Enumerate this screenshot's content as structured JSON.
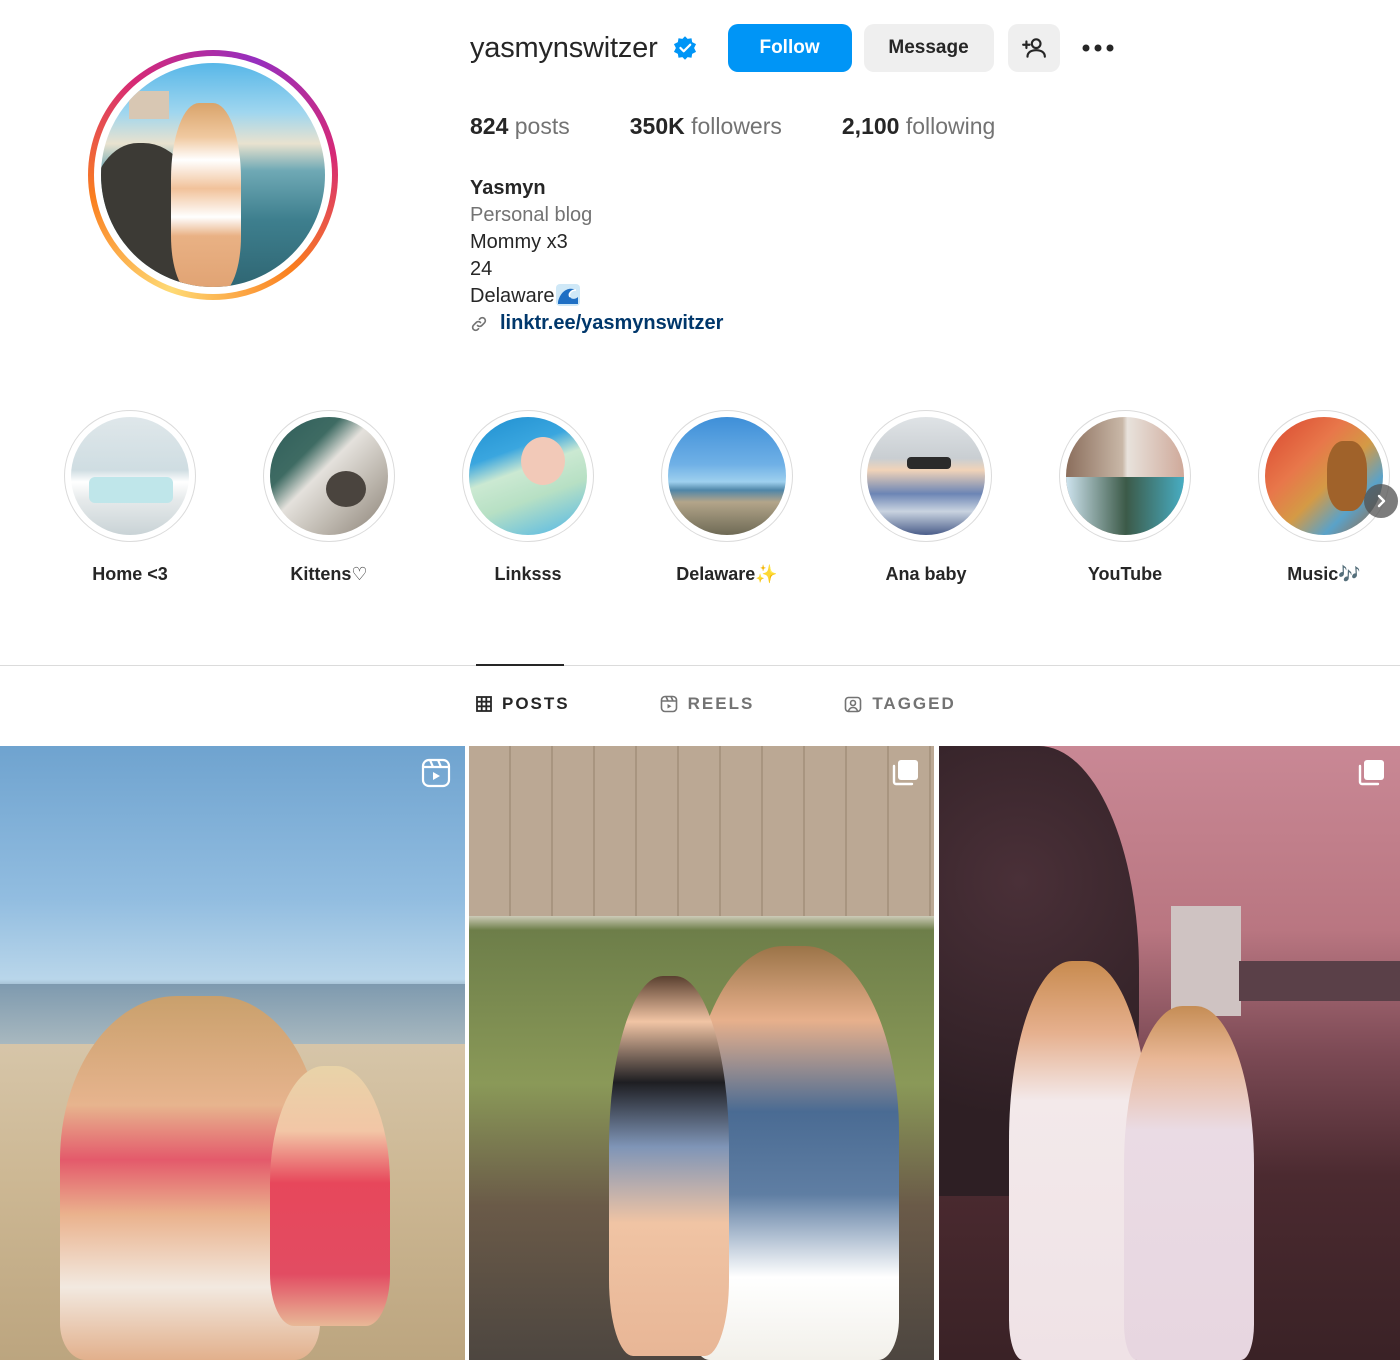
{
  "profile": {
    "username": "yasmynswitzer",
    "verified": true,
    "actions": {
      "follow_label": "Follow",
      "message_label": "Message",
      "add_user_icon": "person-add-icon",
      "more_icon": "more-options-icon"
    },
    "stats": {
      "posts_count": "824",
      "posts_label": "posts",
      "followers_count": "350K",
      "followers_label": "followers",
      "following_count": "2,100",
      "following_label": "following"
    },
    "bio": {
      "name": "Yasmyn",
      "category": "Personal blog",
      "line1": "Mommy x3",
      "line2": "24",
      "line3": "Delaware",
      "line3_emoji_icon": "water-wave-icon",
      "link": "linktr.ee/yasmynswitzer"
    }
  },
  "highlights": [
    {
      "label": "Home <3"
    },
    {
      "label": "Kittens♡"
    },
    {
      "label": "Linksss"
    },
    {
      "label": "Delaware✨"
    },
    {
      "label": "Ana baby"
    },
    {
      "label": "YouTube"
    },
    {
      "label": "Music🎶"
    }
  ],
  "tabs": [
    {
      "label": "POSTS",
      "icon": "grid-icon",
      "active": true
    },
    {
      "label": "REELS",
      "icon": "reels-icon",
      "active": false
    },
    {
      "label": "TAGGED",
      "icon": "tagged-icon",
      "active": false
    }
  ],
  "posts": [
    {
      "badge_icon": "reel-icon"
    },
    {
      "badge_icon": "carousel-icon"
    },
    {
      "badge_icon": "carousel-icon"
    }
  ],
  "colors": {
    "accent": "#0095f6",
    "link": "#00376b",
    "muted": "#737373",
    "button_bg": "#efefef"
  }
}
